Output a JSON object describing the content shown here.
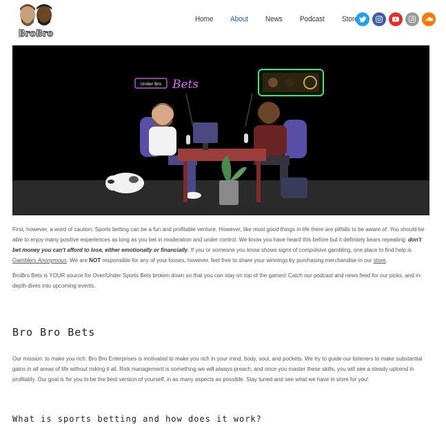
{
  "site": {
    "logo_alt": "BroBro"
  },
  "nav": {
    "items": [
      {
        "label": "Home"
      },
      {
        "label": "About"
      },
      {
        "label": "News"
      },
      {
        "label": "Podcast"
      },
      {
        "label": "Store"
      }
    ]
  },
  "social": [
    "twitter-icon",
    "instagram-icon",
    "youtube-icon",
    "itunes-icon",
    "soundcloud-icon"
  ],
  "hero": {
    "sign_left": "Under Bro",
    "sign_script": "Bets"
  },
  "content": {
    "p1_a": "First, however, a word of caution: Sports betting can be a fun and profitable venture. However, like most good things in life there are pitfalls to be aware of. You should be able to enjoy many positive experiences as long as you bet in moderation and under control. We know you have heard this before but it definitely bears repeating: ",
    "p1_bold": "don't bet money you can't afford to lose, either emotionally or financially",
    "p1_b": ". If you or someone you know shows signs of compulsive gambling, one place to find help is ",
    "p1_link": "Gamblers Anonymous",
    "p1_c": ". We are ",
    "p1_not": "NOT",
    "p1_d": " responsible for any of your losses, however, feel free to share your winnings by purchasing merchandise in our ",
    "p1_store": "store",
    "p1_e": ".",
    "p2": "BroBro Bets is YOUR source for Over/Under Sports Bets broken down so that you can stay on top of the games! Catch our podcast and news feed for our picks, and in-depth dives into upcoming events.",
    "h_bets": "Bro Bro Bets",
    "p3": "Our mission: to make you rich. Bro Bro Enterprises is motivated to make you rich in your mind, body, soul, and pockets. We try to guide our listeners to make substantial gains in all areas of life without risking it all. Risk management is something we will always preach, and once you master these skills, you will see a steady uptrend in profitably. Our goal is for you to be the best version of yourself, in as many aspects as possible. Stay tuned and see what we have in store for you!",
    "h_what": "What is sports betting and how does it work?"
  }
}
